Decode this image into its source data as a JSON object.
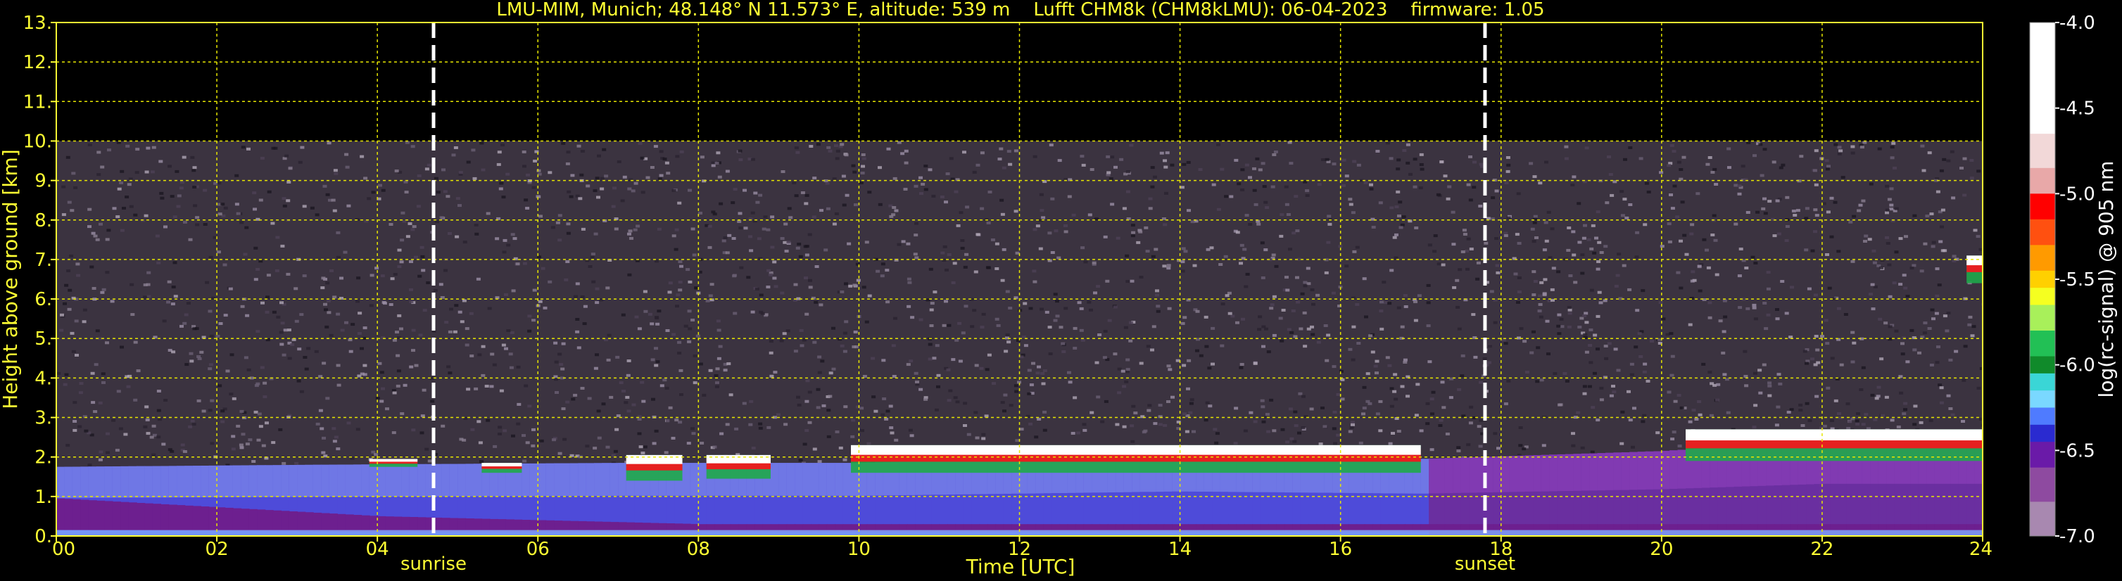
{
  "chart_data": {
    "type": "heatmap",
    "title": "LMU-MIM, Munich; 48.148° N 11.573° E, altitude: 539 m    Lufft CHM8k (CHM8kLMU): 06-04-2023    firmware: 1.05",
    "xlabel": "Time [UTC]",
    "ylabel": "Height above ground [km]",
    "xlim": [
      0,
      24
    ],
    "ylim": [
      0,
      13
    ],
    "x_ticks": [
      "00",
      "02",
      "04",
      "06",
      "08",
      "10",
      "12",
      "14",
      "16",
      "18",
      "20",
      "22",
      "24"
    ],
    "y_ticks": [
      "0.",
      "1.",
      "2.",
      "3.",
      "4.",
      "5.",
      "6.",
      "7.",
      "8.",
      "9.",
      "10.",
      "11.",
      "12.",
      "13."
    ],
    "grid": true,
    "data_top_km": 10,
    "events": [
      {
        "label": "sunrise",
        "time": 4.7
      },
      {
        "label": "sunset",
        "time": 17.8
      }
    ],
    "colorbar": {
      "label": "log(rc-signal) @ 905 nm",
      "range": [
        -7.0,
        -4.0
      ],
      "ticks": [
        "-4.0",
        "-4.5",
        "-5.0",
        "-5.5",
        "-6.0",
        "-6.5",
        "-7.0"
      ]
    },
    "boundary_layer_top_km": [
      {
        "t": 0,
        "h": 1.75
      },
      {
        "t": 3,
        "h": 1.8
      },
      {
        "t": 7,
        "h": 1.85
      },
      {
        "t": 10,
        "h": 1.85
      },
      {
        "t": 14,
        "h": 2.05
      },
      {
        "t": 17,
        "h": 1.95
      },
      {
        "t": 20,
        "h": 2.15
      },
      {
        "t": 22,
        "h": 2.4
      },
      {
        "t": 24,
        "h": 2.4
      }
    ],
    "cloud_layers": [
      {
        "t0": 3.9,
        "t1": 4.5,
        "h0": 1.75,
        "h1": 1.95
      },
      {
        "t0": 5.3,
        "t1": 5.8,
        "h0": 1.6,
        "h1": 1.85
      },
      {
        "t0": 7.1,
        "t1": 7.8,
        "h0": 1.4,
        "h1": 2.05
      },
      {
        "t0": 8.1,
        "t1": 8.9,
        "h0": 1.45,
        "h1": 2.05
      },
      {
        "t0": 9.9,
        "t1": 17.0,
        "h0": 1.6,
        "h1": 2.3
      },
      {
        "t0": 20.3,
        "t1": 24.0,
        "h0": 1.9,
        "h1": 2.7
      },
      {
        "t0": 23.8,
        "t1": 24.0,
        "h0": 6.4,
        "h1": 7.1
      }
    ],
    "aerosol_layer_km": [
      {
        "t": 0,
        "low": 0.15,
        "high": 0.95
      },
      {
        "t": 4,
        "low": 0.1,
        "high": 0.5
      },
      {
        "t": 8,
        "low": 0.1,
        "high": 0.3
      }
    ]
  }
}
